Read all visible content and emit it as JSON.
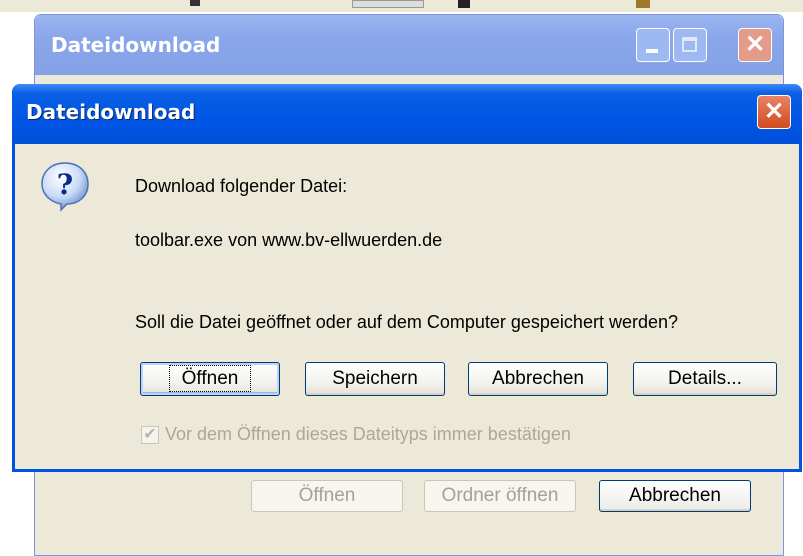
{
  "background_window": {
    "title": "Dateidownload",
    "buttons": {
      "open": "Öffnen",
      "open_folder": "Ordner öffnen",
      "cancel": "Abbrechen"
    }
  },
  "dialog": {
    "title": "Dateidownload",
    "icon": "question-icon",
    "line1": "Download folgender Datei:",
    "filename_line": "toolbar.exe von www.bv-ellwuerden.de",
    "question": "Soll die Datei geöffnet oder auf dem Computer gespeichert werden?",
    "buttons": {
      "open": "Öffnen",
      "save": "Speichern",
      "cancel": "Abbrechen",
      "details": "Details..."
    },
    "checkbox": {
      "label": "Vor dem Öffnen dieses Dateityps immer bestätigen",
      "checked": true,
      "disabled": true
    }
  },
  "colors": {
    "titlebar_active": "#0055e5",
    "titlebar_inactive": "#8aa6ea",
    "dialog_bg": "#ece9d8"
  }
}
